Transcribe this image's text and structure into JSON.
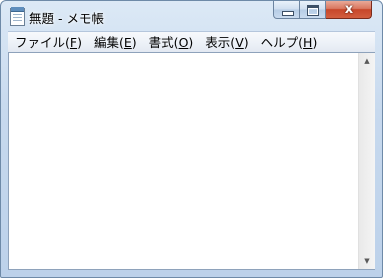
{
  "window": {
    "title": "無題 - メモ帳",
    "icon": "notepad-icon",
    "controls": {
      "minimize_icon": "minimize-icon",
      "maximize_icon": "maximize-icon",
      "close_glyph": "x"
    }
  },
  "menu": [
    {
      "label": "ファイル(",
      "accel": "F",
      "suffix": ")"
    },
    {
      "label": "編集(",
      "accel": "E",
      "suffix": ")"
    },
    {
      "label": "書式(",
      "accel": "O",
      "suffix": ")"
    },
    {
      "label": "表示(",
      "accel": "V",
      "suffix": ")"
    },
    {
      "label": "ヘルプ(",
      "accel": "H",
      "suffix": ")"
    }
  ],
  "editor": {
    "text": ""
  },
  "scrollbar": {
    "up_glyph": "▲",
    "down_glyph": "▼"
  },
  "colors": {
    "frame": "#bcd1ea",
    "close_button": "#c7462a",
    "menubar": "#eef2f8"
  }
}
